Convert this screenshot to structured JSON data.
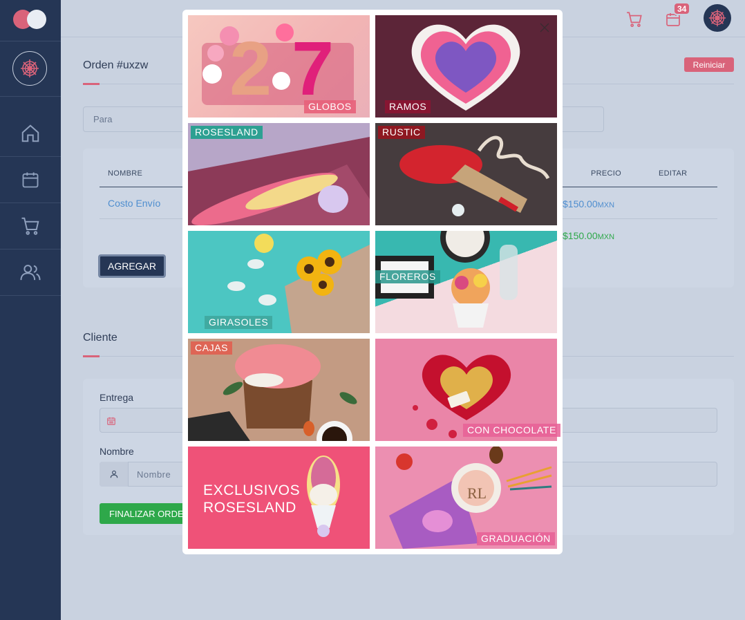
{
  "topbar": {
    "calendar_badge": "34"
  },
  "order": {
    "title": "Orden #uxzw",
    "reset_label": "Reiniciar",
    "para_placeholder": "Para",
    "table": {
      "headers": [
        "NOMBRE",
        "PRECIO",
        "EDITAR"
      ],
      "row": {
        "name": "Costo Envío",
        "price": "$150.00",
        "currency": "MXN"
      },
      "total": {
        "price": "$150.00",
        "currency": "MXN"
      }
    },
    "add_label": "AGREGAR"
  },
  "client": {
    "title": "Cliente",
    "delivery_label": "Entrega",
    "name_label": "Nombre",
    "name_placeholder": "Nombre",
    "finish_label": "FINALIZAR ORDEN"
  },
  "modal": {
    "categories": [
      {
        "label": "GLOBOS"
      },
      {
        "label": "RAMOS"
      },
      {
        "label": "ROSESLAND"
      },
      {
        "label": "RUSTIC"
      },
      {
        "label": "GIRASOLES"
      },
      {
        "label": "FLOREROS"
      },
      {
        "label": "CAJAS"
      },
      {
        "label": "CON CHOCOLATE"
      },
      {
        "label": "EXCLUSIVOS\nROSESLAND"
      },
      {
        "label": "GRADUACIÓN"
      }
    ]
  },
  "colors": {
    "accent": "#d9637a",
    "sidebar": "#253655",
    "success": "#2ea84a",
    "link": "#4f8ecf"
  },
  "icons": [
    "logo-icon",
    "rose-icon",
    "home-icon",
    "calendar-icon",
    "cart-icon",
    "users-icon",
    "close-icon",
    "user-icon"
  ]
}
